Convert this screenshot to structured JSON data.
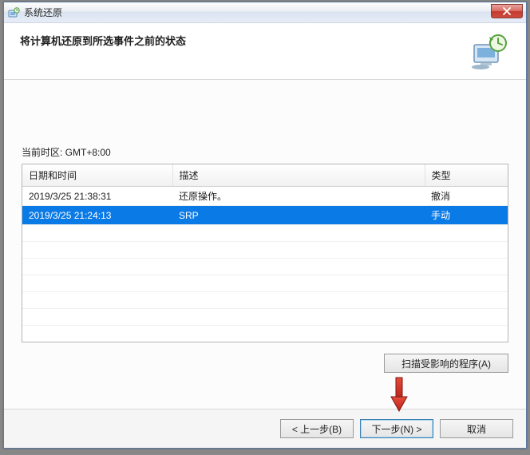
{
  "titlebar": {
    "title": "系统还原"
  },
  "header": {
    "heading": "将计算机还原到所选事件之前的状态"
  },
  "content": {
    "timezone_label": "当前时区: GMT+8:00",
    "columns": {
      "c0": "日期和时间",
      "c1": "描述",
      "c2": "类型"
    },
    "rows": [
      {
        "datetime": "2019/3/25 21:38:31",
        "desc": "还原操作。",
        "type": "撤消",
        "selected": false
      },
      {
        "datetime": "2019/3/25 21:24:13",
        "desc": "SRP",
        "type": "手动",
        "selected": true
      }
    ],
    "scan_button": "扫描受影响的程序(A)"
  },
  "footer": {
    "back": "< 上一步(B)",
    "next": "下一步(N) >",
    "cancel": "取消"
  }
}
